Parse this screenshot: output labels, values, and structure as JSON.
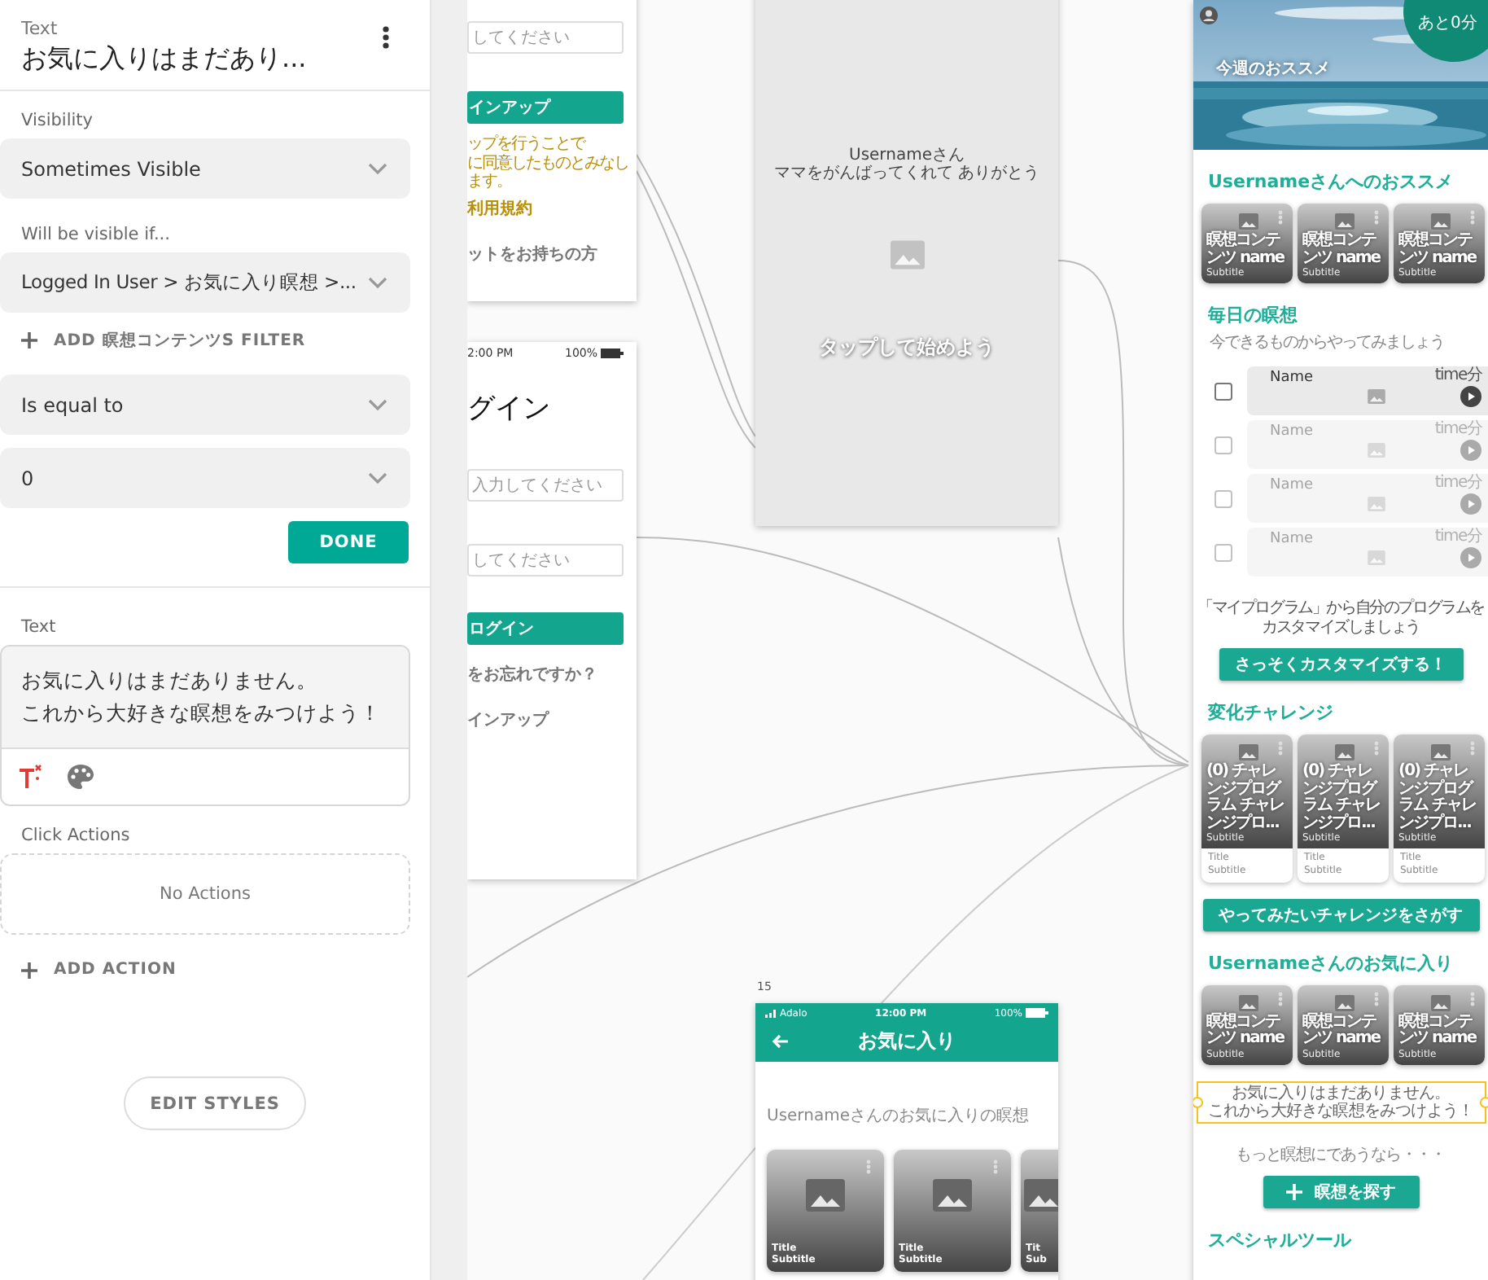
{
  "panel": {
    "label": "Text",
    "title": "お気に入りはまだあり...",
    "visibility": {
      "label": "Visibility",
      "value": "Sometimes Visible"
    },
    "condition": {
      "label": "Will be visible if...",
      "value": "Logged In User > お気に入り瞑想 >..."
    },
    "add_filter": "ADD 瞑想コンテンツS FILTER",
    "operator": "Is equal to",
    "compare_value": "0",
    "done": "DONE",
    "text_label": "Text",
    "text_lines": [
      "お気に入りはまだありません。",
      "これから大好きな瞑想をみつけよう！"
    ],
    "click_actions_label": "Click Actions",
    "no_actions": "No Actions",
    "add_action": "ADD ACTION",
    "edit_styles": "EDIT STYLES"
  },
  "canvas": {
    "signup_screen": {
      "field_placeholder": "してください",
      "button": "インアップ",
      "terms_note_lines": [
        "ップを行うことで",
        "に同意したものとみなします。"
      ],
      "terms_link": "利用規約",
      "account_link": "ットをお持ちの方"
    },
    "login_screen": {
      "time": "2:00 PM",
      "battery": "100%",
      "title": "グイン",
      "email_placeholder": "入力してください",
      "password_placeholder": "してください",
      "button": "ログイン",
      "forgot_link": "をお忘れですか？",
      "signup_link": "インアップ"
    },
    "splash_screen": {
      "greeting_lines": [
        "Usernameさん",
        "ママをがんばってくれて ありがとう"
      ],
      "tap_text": "タップして始めよう"
    },
    "favorites_screen": {
      "number": "15",
      "carrier": "Adalo",
      "time": "12:00 PM",
      "battery": "100%",
      "title": "お気に入り",
      "section_title": "Usernameさんのお気に入りの瞑想",
      "cards": [
        {
          "title": "Title",
          "subtitle": "Subtitle"
        },
        {
          "title": "Title",
          "subtitle": "Subtitle"
        },
        {
          "title": "Tit",
          "subtitle": "Sub"
        }
      ]
    },
    "home_screen": {
      "header_caption": "今週のおススメ",
      "remaining": "あと0分",
      "recommend_title": "Usernameさんへのおススメ",
      "recommend_cards": [
        {
          "title": "瞑想コンテンツ name",
          "subtitle": "Subtitle"
        },
        {
          "title": "瞑想コンテンツ name",
          "subtitle": "Subtitle"
        },
        {
          "title": "瞑想コンテンツ name",
          "subtitle": "Subtitle"
        }
      ],
      "daily_title": "毎日の瞑想",
      "daily_subtitle": "今できるものからやってみましょう",
      "daily_rows": [
        {
          "name": "Name",
          "time": "time分",
          "checked": false,
          "dimmed": false
        },
        {
          "name": "Name",
          "time": "time分",
          "checked": false,
          "dimmed": true
        },
        {
          "name": "Name",
          "time": "time分",
          "checked": false,
          "dimmed": true
        },
        {
          "name": "Name",
          "time": "time分",
          "checked": false,
          "dimmed": true
        }
      ],
      "customize_lines": [
        "「マイプログラム」から自分のプログラムを",
        "カスタマイズしましょう"
      ],
      "customize_button": "さっそくカスタマイズする！",
      "challenge_title": "変化チャレンジ",
      "challenge_cards": [
        {
          "title": "(0) チャレンジプログラム チャレンジプロ...",
          "subtitle": "Subtitle",
          "caption_title": "Title",
          "caption_subtitle": "Subtitle"
        },
        {
          "title": "(0) チャレンジプログラム チャレンジプロ...",
          "subtitle": "Subtitle",
          "caption_title": "Title",
          "caption_subtitle": "Subtitle"
        },
        {
          "title": "(0) チャレンジプログラム チャレンジプロ...",
          "subtitle": "Subtitle",
          "caption_title": "Title",
          "caption_subtitle": "Subtitle"
        }
      ],
      "challenge_button": "やってみたいチャレンジをさがす",
      "favorites_title": "Usernameさんのお気に入り",
      "favorite_cards": [
        {
          "title": "瞑想コンテンツ name",
          "subtitle": "Subtitle"
        },
        {
          "title": "瞑想コンテンツ name",
          "subtitle": "Subtitle"
        },
        {
          "title": "瞑想コンテンツ name",
          "subtitle": "Subtitle"
        }
      ],
      "empty_message": {
        "lines": [
          "お気に入りはまだありません。",
          "これから大好きな瞑想をみつけよう！"
        ],
        "selected": true
      },
      "more_text": "もっと瞑想にであうなら・・・",
      "find_button": "瞑想を探す",
      "special_title": "スペシャルツール"
    }
  }
}
